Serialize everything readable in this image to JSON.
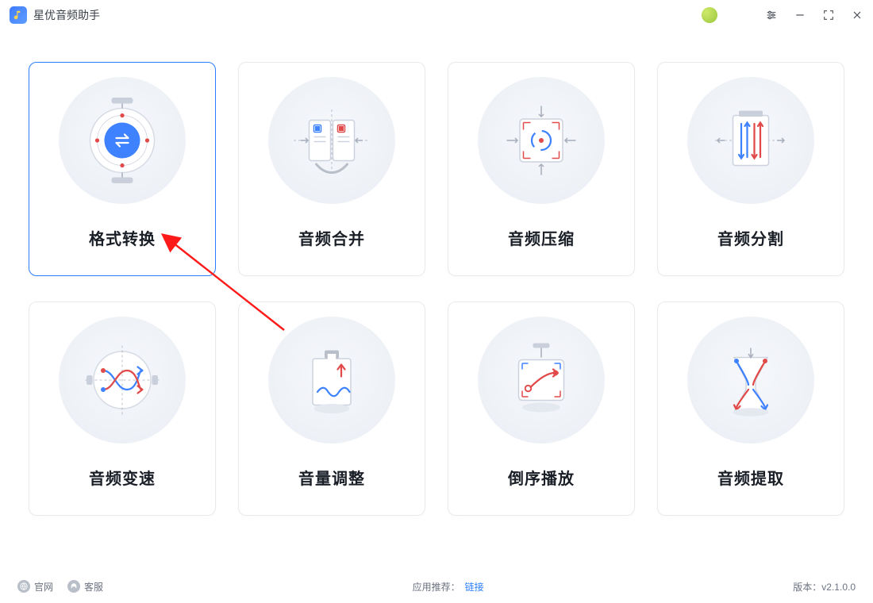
{
  "app": {
    "title": "星优音频助手"
  },
  "cards": [
    {
      "label": "格式转换",
      "selected": true
    },
    {
      "label": "音频合并",
      "selected": false
    },
    {
      "label": "音频压缩",
      "selected": false
    },
    {
      "label": "音频分割",
      "selected": false
    },
    {
      "label": "音频变速",
      "selected": false
    },
    {
      "label": "音量调整",
      "selected": false
    },
    {
      "label": "倒序播放",
      "selected": false
    },
    {
      "label": "音频提取",
      "selected": false
    }
  ],
  "footer": {
    "website_label": "官网",
    "support_label": "客服",
    "recommend_label": "应用推荐：",
    "recommend_link": "链接",
    "version_label": "版本：",
    "version_value": "v2.1.0.0"
  },
  "colors": {
    "blue": "#2a7dff",
    "red": "#e24a4a",
    "grey": "#a6adbb",
    "circle_bg": "#eef1f6"
  }
}
